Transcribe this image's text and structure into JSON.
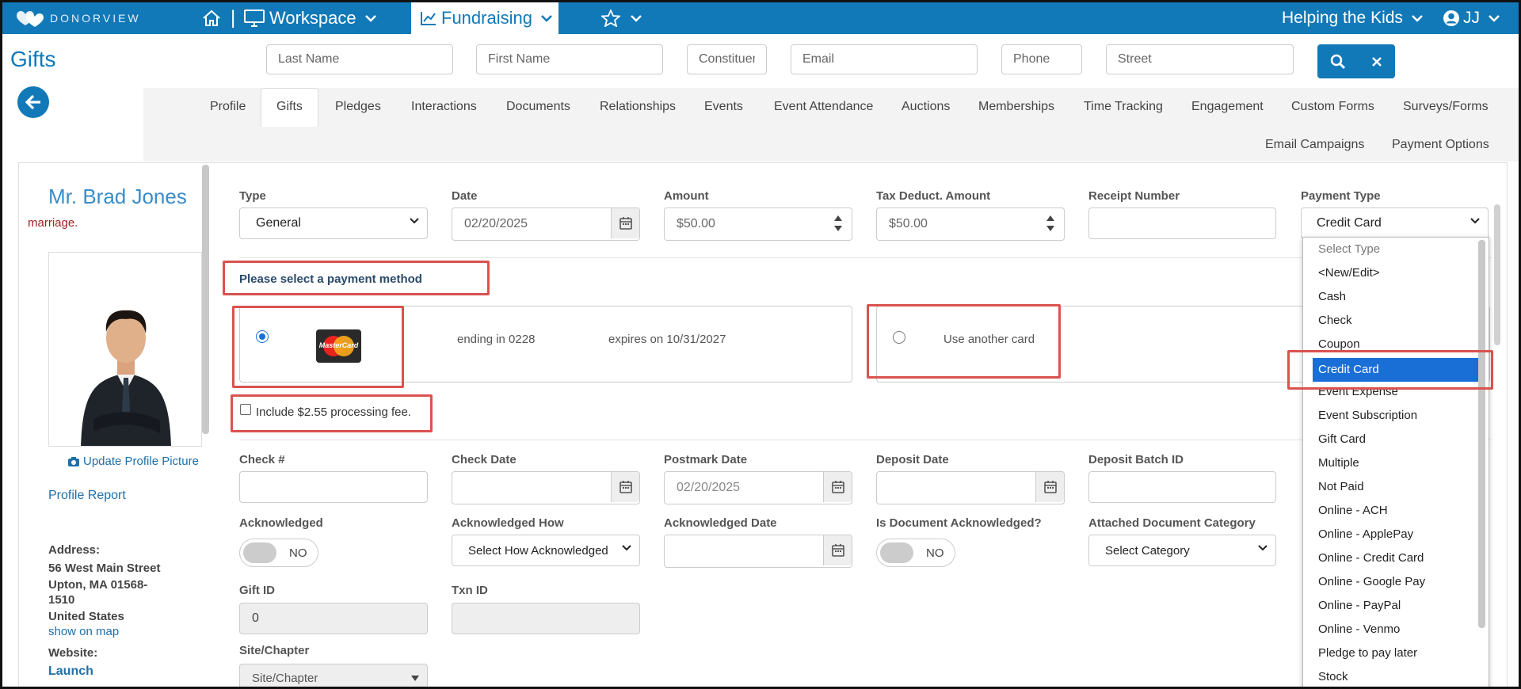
{
  "topbar": {
    "logo_text": "DONORVIEW",
    "workspace_label": "Workspace",
    "fundraising_label": "Fundraising",
    "org_label": "Helping the Kids",
    "user_initials": "JJ",
    "colors": {
      "brand": "#1179b8",
      "highlight": "#d9534f",
      "selected": "#1a6fd6"
    }
  },
  "page": {
    "title": "Gifts"
  },
  "search": {
    "last_name": "Last Name",
    "first_name": "First Name",
    "constituent": "Constituen",
    "email": "Email",
    "phone": "Phone",
    "street": "Street"
  },
  "tabs": [
    "Profile",
    "Gifts",
    "Pledges",
    "Interactions",
    "Documents",
    "Relationships",
    "Events",
    "Event Attendance",
    "Auctions",
    "Memberships",
    "Time Tracking",
    "Engagement",
    "Custom Forms",
    "Surveys/Forms",
    "Email Campaigns",
    "Payment Options"
  ],
  "profile": {
    "name": "Mr. Brad Jones",
    "note": "marriage.",
    "update_picture": "Update Profile Picture",
    "profile_report": "Profile Report",
    "address_label": "Address:",
    "address_line1": "56 West Main Street",
    "address_line2": "Upton, MA 01568-",
    "address_line3": "1510",
    "address_line4": "United States",
    "show_on_map": "show on map",
    "website_label": "Website:",
    "website_link": "Launch"
  },
  "form": {
    "type_label": "Type",
    "type_value": "General",
    "date_label": "Date",
    "date_value": "02/20/2025",
    "amount_label": "Amount",
    "amount_value": "$50.00",
    "tax_label": "Tax Deduct. Amount",
    "tax_value": "$50.00",
    "receipt_label": "Receipt Number",
    "payment_type_label": "Payment Type",
    "payment_type_value": "Credit Card",
    "select_method": "Please select a payment method",
    "card_brand": "MasterCard",
    "card_ending": "ending in 0228",
    "card_expires": "expires on 10/31/2027",
    "use_another": "Use another card",
    "processing_fee": "Include $2.55 processing fee.",
    "check_label": "Check #",
    "check_date_label": "Check Date",
    "postmark_label": "Postmark Date",
    "postmark_value": "02/20/2025",
    "deposit_date_label": "Deposit Date",
    "deposit_batch_label": "Deposit Batch ID",
    "acknowledged_label": "Acknowledged",
    "acknowledged_value": "NO",
    "ack_how_label": "Acknowledged How",
    "ack_how_value": "Select How Acknowledged",
    "ack_date_label": "Acknowledged Date",
    "doc_ack_label": "Is Document Acknowledged?",
    "doc_ack_value": "NO",
    "attached_cat_label": "Attached Document Category",
    "attached_cat_value": "Select Category",
    "gift_id_label": "Gift ID",
    "gift_id_value": "0",
    "txn_id_label": "Txn ID",
    "site_label": "Site/Chapter",
    "site_value": "Site/Chapter"
  },
  "dropdown": {
    "items": [
      "Select Type",
      "<New/Edit>",
      "Cash",
      "Check",
      "Coupon",
      "Credit Card",
      "Event Expense",
      "Event Subscription",
      "Gift Card",
      "Multiple",
      "Not Paid",
      "Online - ACH",
      "Online - ApplePay",
      "Online - Credit Card",
      "Online - Google Pay",
      "Online - PayPal",
      "Online - Venmo",
      "Pledge to pay later",
      "Stock"
    ],
    "selected": "Credit Card"
  }
}
